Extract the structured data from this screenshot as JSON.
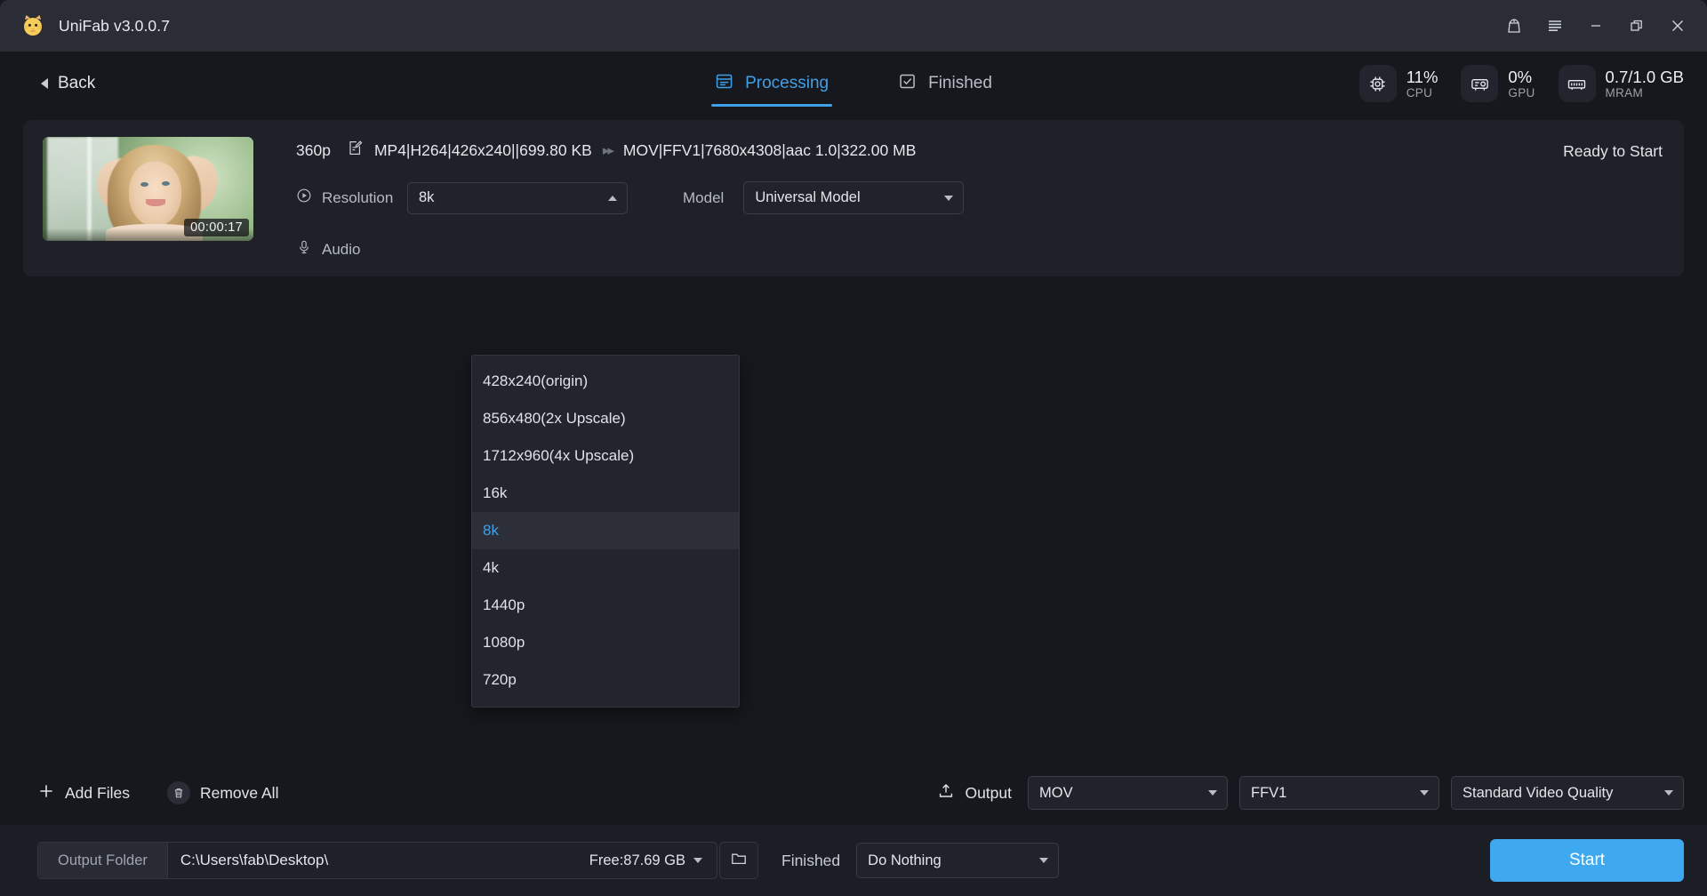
{
  "titlebar": {
    "app_title": "UniFab v3.0.0.7",
    "logo_icon": "cat-logo-icon",
    "gift_icon": "gift-icon",
    "menu_icon": "hamburger-menu-icon",
    "minimize_icon": "minimize-icon",
    "maximize_icon": "maximize-icon",
    "close_icon": "close-icon"
  },
  "nav": {
    "back_label": "Back",
    "back_icon": "chevron-left-icon",
    "tabs": [
      {
        "label": "Processing",
        "icon": "list-panel-icon",
        "active": true
      },
      {
        "label": "Finished",
        "icon": "checkbox-icon",
        "active": false
      }
    ],
    "stats": [
      {
        "icon": "cpu-chip-icon",
        "value": "11%",
        "label": "CPU"
      },
      {
        "icon": "gpu-card-icon",
        "value": "0%",
        "label": "GPU"
      },
      {
        "icon": "memory-ram-icon",
        "value": "0.7/1.0 GB",
        "label": "MRAM"
      }
    ]
  },
  "task": {
    "thumbnail_duration": "00:00:17",
    "source_resolution": "360p",
    "edit_icon": "edit-file-icon",
    "source_info": "MP4|H264|426x240||699.80 KB",
    "convert_icon": "double-chevron-right-icon",
    "target_info": "MOV|FFV1|7680x4308|aac 1.0|322.00 MB",
    "status": "Ready to Start",
    "resolution_label": "Resolution",
    "resolution_icon": "play-circle-icon",
    "resolution_value": "8k",
    "audio_label": "Audio",
    "audio_icon": "microphone-icon",
    "model_label": "Model",
    "model_value": "Universal Model"
  },
  "resolution_dropdown": {
    "open": true,
    "selected": "8k",
    "options": [
      "428x240(origin)",
      "856x480(2x Upscale)",
      "1712x960(4x Upscale)",
      "16k",
      "8k",
      "4k",
      "1440p",
      "1080p",
      "720p"
    ]
  },
  "bottom_toolbar": {
    "add_files_label": "Add Files",
    "add_files_icon": "plus-icon",
    "remove_all_label": "Remove All",
    "remove_all_icon": "trash-icon",
    "output_label": "Output",
    "output_icon": "upload-icon",
    "output_format": "MOV",
    "output_codec": "FFV1",
    "output_quality": "Standard Video Quality"
  },
  "folder_bar": {
    "output_folder_label": "Output Folder",
    "output_folder_path": "C:\\Users\\fab\\Desktop\\",
    "free_space": "Free:87.69 GB",
    "folder_icon": "folder-icon",
    "finished_label": "Finished",
    "finished_action": "Do Nothing",
    "start_label": "Start"
  },
  "colors": {
    "accent": "#3fa0e8",
    "start_button": "#3fa9f0",
    "window_bg": "#17181d",
    "titlebar_bg": "#2a2c36",
    "card_bg": "#1f2129"
  }
}
